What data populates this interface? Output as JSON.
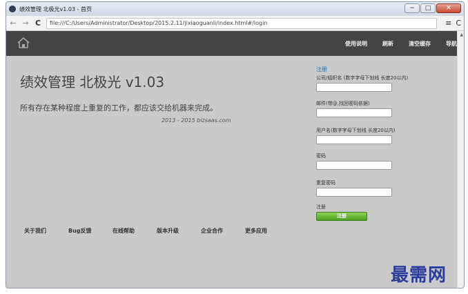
{
  "window": {
    "title": "绩效管理 北极光v1.03 - 首页"
  },
  "toolbar": {
    "url": "file:///C:/Users/Administrator/Desktop/2015.2.11/jixiaoguanli/index.html#/login",
    "back_icon": "back-arrow-icon",
    "forward_icon": "forward-arrow-icon",
    "reload_icon": "reload-icon",
    "menu_icon": "hamburger-menu-icon"
  },
  "navbar": {
    "home_icon": "home-icon",
    "links": [
      "使用说明",
      "刷新",
      "清空缓存",
      "导航"
    ]
  },
  "hero": {
    "title": "绩效管理 北极光 v1.03",
    "subtitle": "所有存在某种程度上重复的工作，都应该交给机器来完成。",
    "copyright": "2013 - 2015 bizsaas.com"
  },
  "register": {
    "title": "注册",
    "fields": [
      {
        "label": "公司/组织名 (数字字母下划线 长度20以内)",
        "value": ""
      },
      {
        "label": "邮件(带@,找回密码依据)",
        "value": ""
      },
      {
        "label": "用户名(数字字母下划线 长度20以内)",
        "value": ""
      },
      {
        "label": "密码",
        "value": ""
      },
      {
        "label": "重复密码",
        "value": ""
      }
    ],
    "submit_caption": "注册",
    "submit_label": "注册"
  },
  "footer": {
    "links": [
      "关于我们",
      "Bug反馈",
      "在线帮助",
      "版本升级",
      "企业合作",
      "更多应用"
    ]
  },
  "watermark": "最需网",
  "colors": {
    "navbar_bg": "#444444",
    "content_bg": "#cacaca",
    "submit_green": "#4aa21b",
    "register_link": "#2a6fb8"
  }
}
